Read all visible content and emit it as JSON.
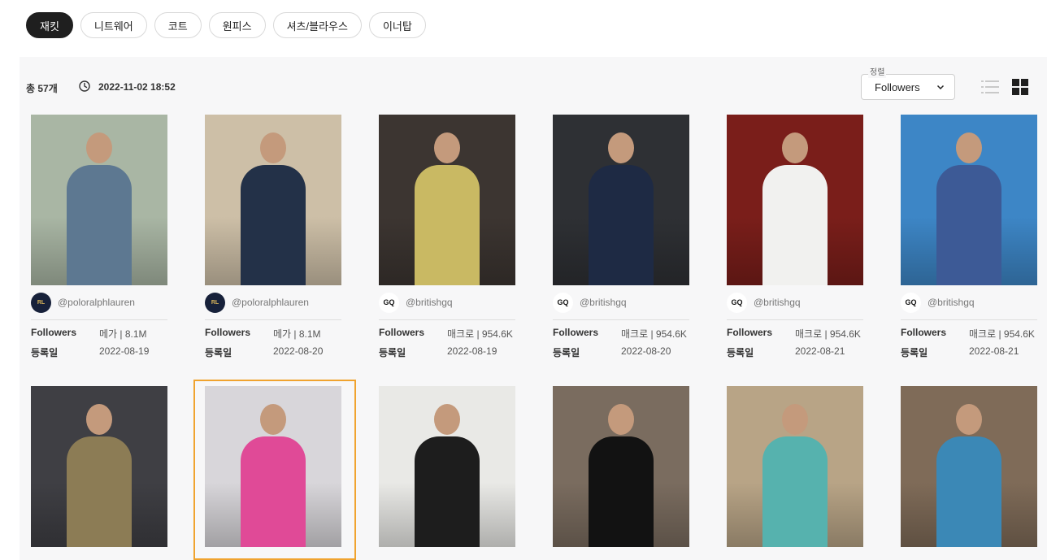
{
  "categories": [
    {
      "label": "재킷",
      "active": true
    },
    {
      "label": "니트웨어",
      "active": false
    },
    {
      "label": "코트",
      "active": false
    },
    {
      "label": "원피스",
      "active": false
    },
    {
      "label": "셔츠/블라우스",
      "active": false
    },
    {
      "label": "이너탑",
      "active": false
    }
  ],
  "toolbar": {
    "total": "총 57개",
    "datetime": "2022-11-02 18:52",
    "sort_label": "정렬",
    "sort_value": "Followers"
  },
  "labels": {
    "followers": "Followers",
    "registered": "등록일"
  },
  "cards_row1": [
    {
      "handle": "@poloralphlauren",
      "avatar": "rl",
      "tier": "메가 | 8.1M",
      "date": "2022-08-19",
      "bg": "#a9b6a4",
      "fg": "#5d7891"
    },
    {
      "handle": "@poloralphlauren",
      "avatar": "rl",
      "tier": "메가 | 8.1M",
      "date": "2022-08-20",
      "bg": "#cdbfa7",
      "fg": "#233148"
    },
    {
      "handle": "@britishgq",
      "avatar": "gq",
      "tier": "매크로 | 954.6K",
      "date": "2022-08-19",
      "bg": "#3c3531",
      "fg": "#c9b963"
    },
    {
      "handle": "@britishgq",
      "avatar": "gq",
      "tier": "매크로 | 954.6K",
      "date": "2022-08-20",
      "bg": "#2e3034",
      "fg": "#1e2a44"
    },
    {
      "handle": "@britishgq",
      "avatar": "gq",
      "tier": "매크로 | 954.6K",
      "date": "2022-08-21",
      "bg": "#7a1e1a",
      "fg": "#f1f1ef"
    },
    {
      "handle": "@britishgq",
      "avatar": "gq",
      "tier": "매크로 | 954.6K",
      "date": "2022-08-21",
      "bg": "#3d86c6",
      "fg": "#3d5a96"
    }
  ],
  "cards_row2": [
    {
      "bg": "#3f3f44",
      "fg": "#8c7c55"
    },
    {
      "bg": "#d8d6da",
      "fg": "#e04a97"
    },
    {
      "bg": "#e9e9e6",
      "fg": "#1d1d1d"
    },
    {
      "bg": "#7a6c5f",
      "fg": "#121212"
    },
    {
      "bg": "#b8a486",
      "fg": "#56b2ae"
    },
    {
      "bg": "#7f6b58",
      "fg": "#3b88b6"
    }
  ],
  "icons": {
    "clock": "clock-icon",
    "chevron": "chevron-down-icon",
    "list": "list-view-icon",
    "grid": "grid-view-icon"
  },
  "colors": {
    "accent": "#1f1f1f",
    "selected": "#f0a32f"
  }
}
